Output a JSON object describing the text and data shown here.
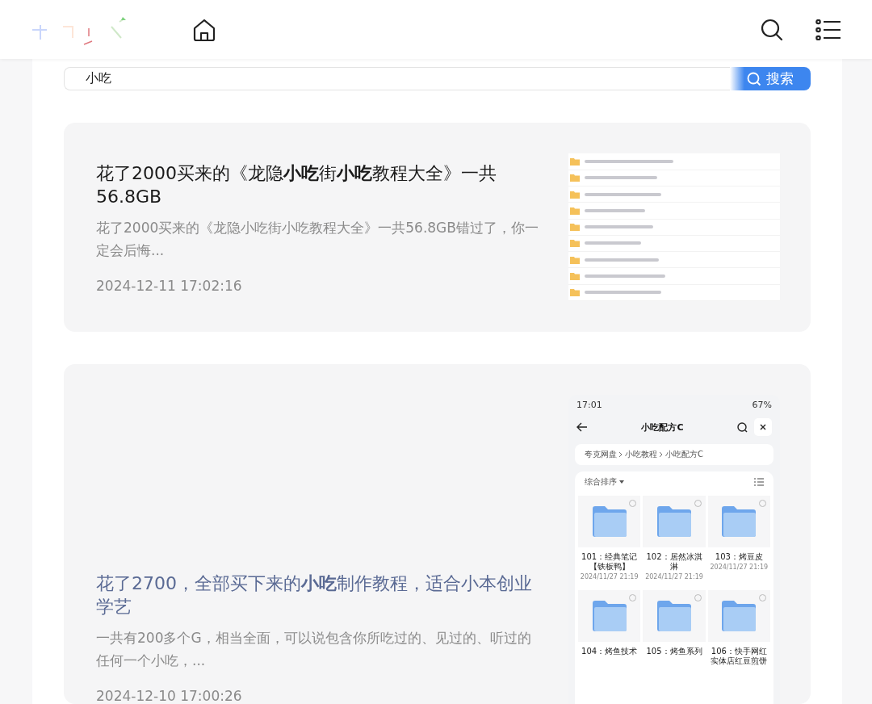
{
  "search": {
    "value": "小吃",
    "button": "搜索"
  },
  "results": [
    {
      "title": "花了2000买来的《龙隐**小吃**街**小吃**教程大全》一共56.8GB",
      "summary": "花了2000买来的《龙隐小吃街小吃教程大全》一共56.8GB错过了，你一定会后悔...",
      "date": "2024-12-11 17:02:16",
      "visited": false,
      "thumbnail": {
        "kind": "file_list"
      }
    },
    {
      "title": "花了2700，全部买下来的**小吃**制作教程，适合小本创业学艺",
      "summary": "一共有200多个G，相当全面，可以说包含你所吃过的、见过的、听过的任何一个小吃，...",
      "date": "2024-12-10 17:00:26",
      "visited": true,
      "thumbnail": {
        "kind": "phone",
        "time": "17:01",
        "battery": "67%",
        "title": "小吃配方C",
        "breadcrumb": [
          "夸克网盘",
          "小吃教程",
          "小吃配方C"
        ],
        "sort": "综合排序",
        "folders": [
          {
            "name": "101：经典笔记【铁板鸭】",
            "date": "2024/11/27 21:19"
          },
          {
            "name": "102：居然冰淇淋",
            "date": "2024/11/27 21:19"
          },
          {
            "name": "103：烤豆皮",
            "date": "2024/11/27 21:19"
          },
          {
            "name": "104：烤鱼技术"
          },
          {
            "name": "105：烤鱼系列"
          },
          {
            "name": "106：快手网红实体店红豆煎饼"
          }
        ]
      }
    }
  ]
}
